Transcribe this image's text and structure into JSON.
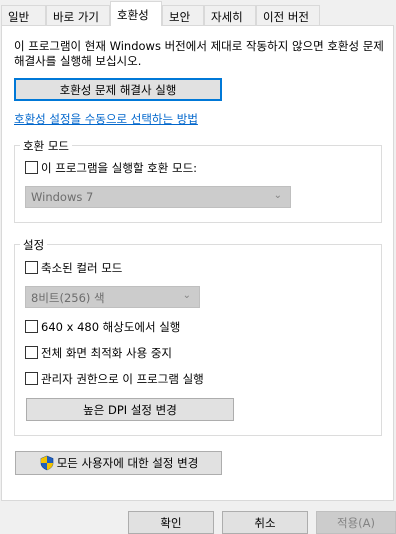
{
  "tabs": [
    {
      "label": "일반"
    },
    {
      "label": "바로 가기"
    },
    {
      "label": "호환성"
    },
    {
      "label": "보안"
    },
    {
      "label": "자세히"
    },
    {
      "label": "이전 버전"
    }
  ],
  "intro_text": "이 프로그램이 현재 Windows 버전에서 제대로 작동하지 않으면 호환성 문제 해결사를 실행해 보십시오.",
  "troubleshooter_button": "호환성 문제 해결사 실행",
  "manual_link": "호환성 설정을 수동으로 선택하는 방법",
  "compat_mode": {
    "group_title": "호환 모드",
    "checkbox_label": "이 프로그램을 실행할 호환 모드:",
    "selected_os": "Windows 7"
  },
  "settings": {
    "group_title": "설정",
    "reduced_color_label": "축소된 컬러 모드",
    "color_selected": "8비트(256) 색",
    "res_640_label": "640 x 480 해상도에서 실행",
    "fullscreen_opt_label": "전체 화면 최적화 사용 중지",
    "admin_label": "관리자 권한으로 이 프로그램 실행",
    "dpi_button": "높은 DPI 설정 변경"
  },
  "all_users_button": "모든 사용자에 대한 설정 변경",
  "footer": {
    "ok": "확인",
    "cancel": "취소",
    "apply": "적용(A)"
  }
}
